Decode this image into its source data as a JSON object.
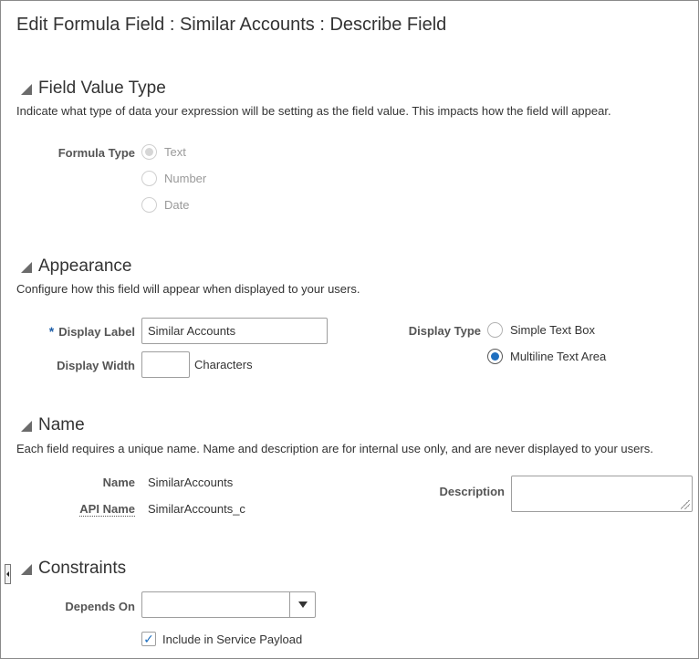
{
  "page": {
    "title": "Edit Formula Field : Similar Accounts : Describe Field"
  },
  "field_value_type": {
    "title": "Field Value Type",
    "description": "Indicate what type of data your expression will be setting as the field value. This impacts how the field will appear.",
    "formula_type_label": "Formula Type",
    "options": [
      "Text",
      "Number",
      "Date"
    ],
    "selected": "Text"
  },
  "appearance": {
    "title": "Appearance",
    "description": "Configure how this field will appear when displayed to your users.",
    "required_marker": "*",
    "display_label_label": "Display Label",
    "display_label_value": "Similar Accounts",
    "display_width_label": "Display Width",
    "display_width_value": "",
    "display_width_unit": "Characters",
    "display_type_label": "Display Type",
    "display_type_options": [
      "Simple Text Box",
      "Multiline Text Area"
    ],
    "display_type_selected": "Multiline Text Area"
  },
  "name_section": {
    "title": "Name",
    "description": "Each field requires a unique name. Name and description are for internal use only, and are never displayed to your users.",
    "name_label": "Name",
    "name_value": "SimilarAccounts",
    "api_name_label": "API Name",
    "api_name_value": "SimilarAccounts_c",
    "description_label": "Description",
    "description_value": ""
  },
  "constraints": {
    "title": "Constraints",
    "depends_on_label": "Depends On",
    "depends_on_value": "",
    "include_payload_label": "Include in Service Payload",
    "include_payload_checked": true
  },
  "icons": {
    "section_toggle": "collapse-triangle-icon",
    "dropdown": "caret-down-icon",
    "checkbox": "checkmark-icon",
    "side_panel": "panel-collapse-icon"
  },
  "colors": {
    "accent": "#1f6fbf",
    "required": "#1f5fa8",
    "text": "#333333",
    "label": "#555555"
  }
}
